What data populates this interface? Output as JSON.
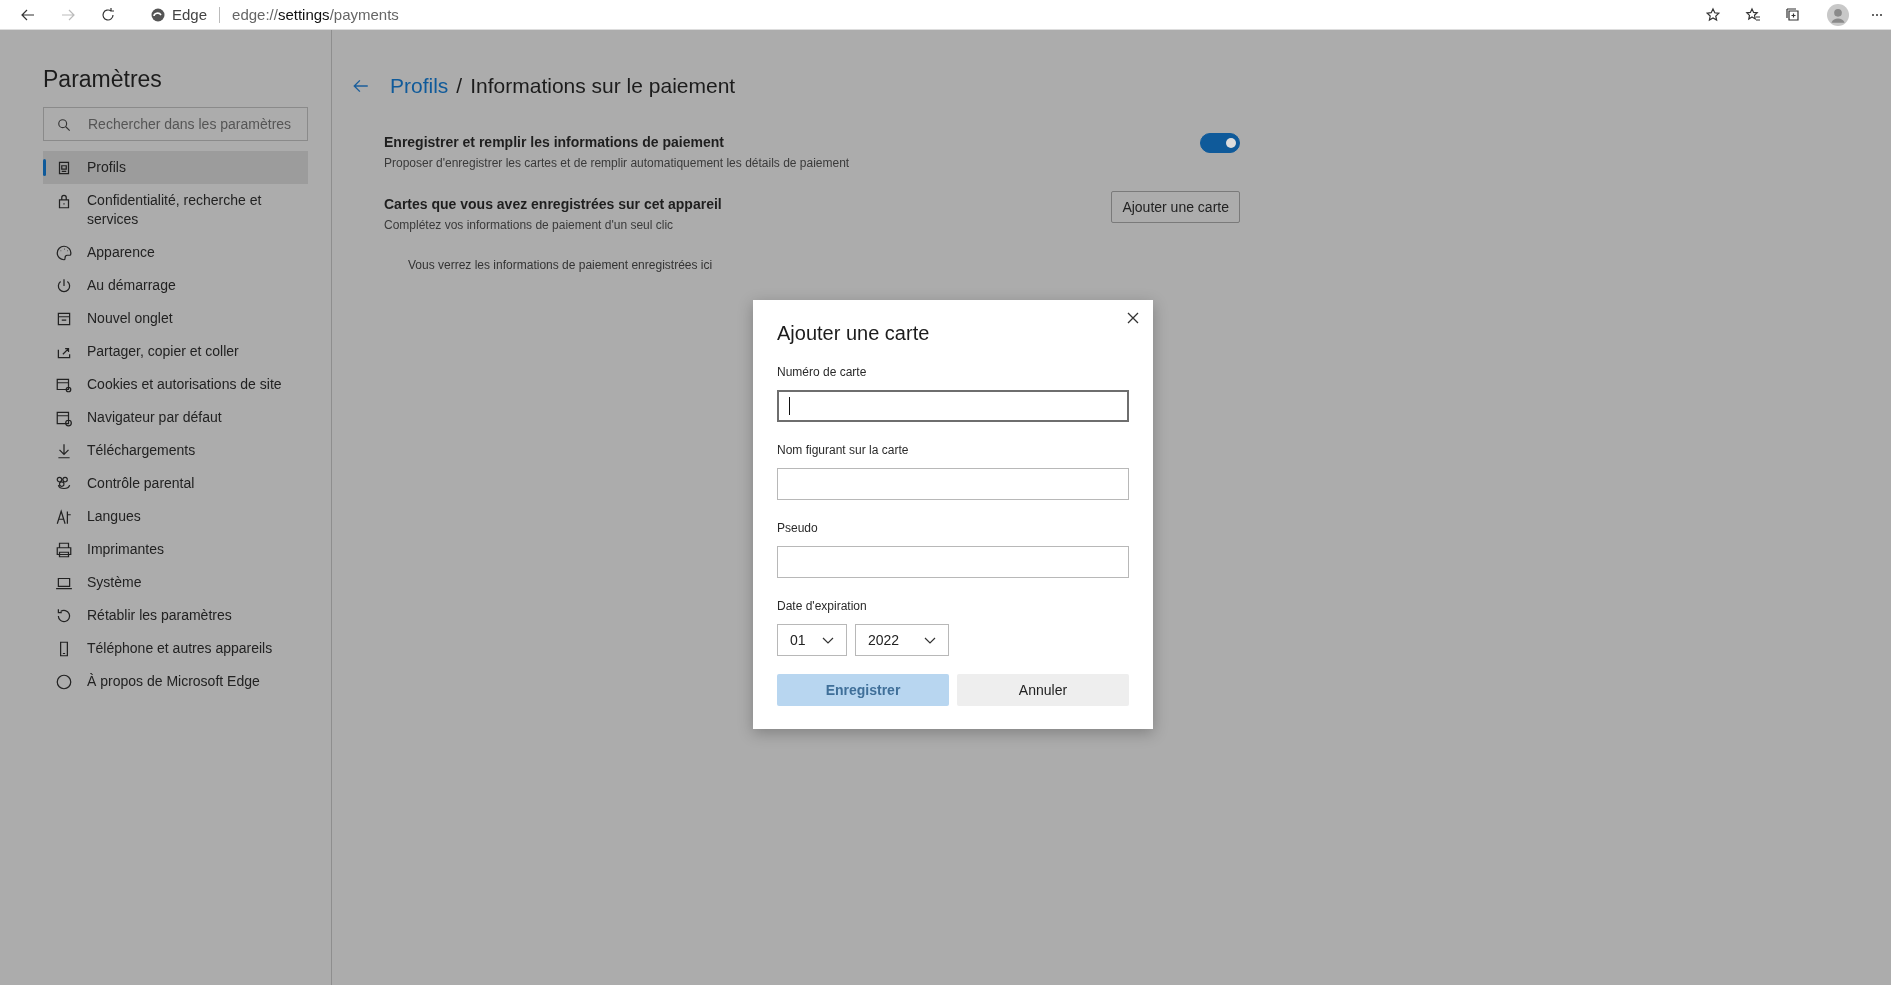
{
  "browser": {
    "app_name": "Edge",
    "address": {
      "prefix": "edge://",
      "host": "settings",
      "path": "/payments"
    }
  },
  "sidebar": {
    "title": "Paramètres",
    "search": {
      "placeholder": "Rechercher dans les paramètres"
    },
    "items": [
      {
        "label": "Profils",
        "selected": true
      },
      {
        "label": "Confidentialité, recherche et services",
        "selected": false
      },
      {
        "label": "Apparence",
        "selected": false
      },
      {
        "label": "Au démarrage",
        "selected": false
      },
      {
        "label": "Nouvel onglet",
        "selected": false
      },
      {
        "label": "Partager, copier et coller",
        "selected": false
      },
      {
        "label": "Cookies et autorisations de site",
        "selected": false
      },
      {
        "label": "Navigateur par défaut",
        "selected": false
      },
      {
        "label": "Téléchargements",
        "selected": false
      },
      {
        "label": "Contrôle parental",
        "selected": false
      },
      {
        "label": "Langues",
        "selected": false
      },
      {
        "label": "Imprimantes",
        "selected": false
      },
      {
        "label": "Système",
        "selected": false
      },
      {
        "label": "Rétablir les paramètres",
        "selected": false
      },
      {
        "label": "Téléphone et autres appareils",
        "selected": false
      },
      {
        "label": "À propos de Microsoft Edge",
        "selected": false
      }
    ]
  },
  "header": {
    "breadcrumb_link": "Profils",
    "separator": "/",
    "title": "Informations sur le paiement"
  },
  "settings": [
    {
      "title": "Enregistrer et remplir les informations de paiement",
      "description": "Proposer d'enregistrer les cartes et de remplir automatiquement les détails de paiement",
      "kind": "toggle",
      "on": true
    },
    {
      "title": "Cartes que vous avez enregistrées sur cet appareil",
      "description": "Complétez vos informations de paiement d'un seul clic",
      "kind": "button",
      "button": "Ajouter une carte"
    }
  ],
  "empty_message": "Vous verrez les informations de paiement enregistrées ici",
  "dialog": {
    "title": "Ajouter une carte",
    "fields": [
      {
        "label": "Numéro de carte",
        "focused": true
      },
      {
        "label": "Nom figurant sur la carte",
        "focused": false
      },
      {
        "label": "Pseudo",
        "focused": false
      }
    ],
    "expiration": {
      "label": "Date d'expiration",
      "month": "01",
      "year": "2022"
    },
    "save": {
      "label": "Enregistrer",
      "disabled": true
    },
    "cancel": {
      "label": "Annuler"
    }
  }
}
